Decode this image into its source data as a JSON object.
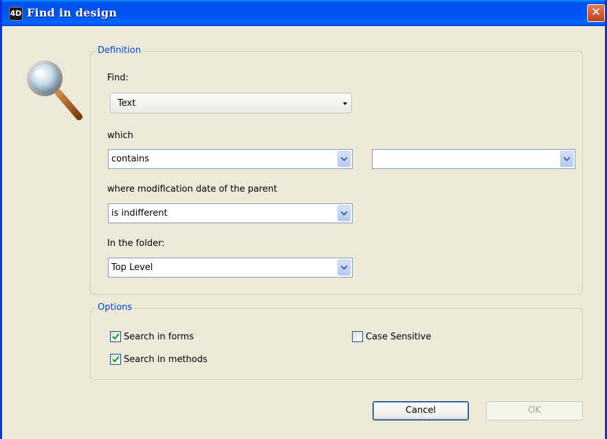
{
  "window": {
    "title": "Find in design",
    "app_icon_text": "4D",
    "close_glyph": "✕"
  },
  "definition": {
    "legend": "Definition",
    "find_label": "Find:",
    "find_value": "Text",
    "which_label": "which",
    "which_value": "contains",
    "which_extra_value": "",
    "date_label": "where modification date of the parent",
    "date_value": "is indifferent",
    "folder_label": "In the folder:",
    "folder_value": "Top Level"
  },
  "options": {
    "legend": "Options",
    "search_forms": {
      "label": "Search in forms",
      "checked": true
    },
    "search_methods": {
      "label": "Search in methods",
      "checked": true
    },
    "case_sensitive": {
      "label": "Case Sensitive",
      "checked": false
    }
  },
  "buttons": {
    "cancel": "Cancel",
    "ok": "OK"
  },
  "icons": {
    "magnifier": "magnifier-icon",
    "dropdown": "chevron-down-icon",
    "check": "checkmark-icon"
  },
  "colors": {
    "titlebar": "#0054e3",
    "dialog_bg": "#ece9d8",
    "legend_text": "#0046d5",
    "check_green": "#21a121"
  }
}
